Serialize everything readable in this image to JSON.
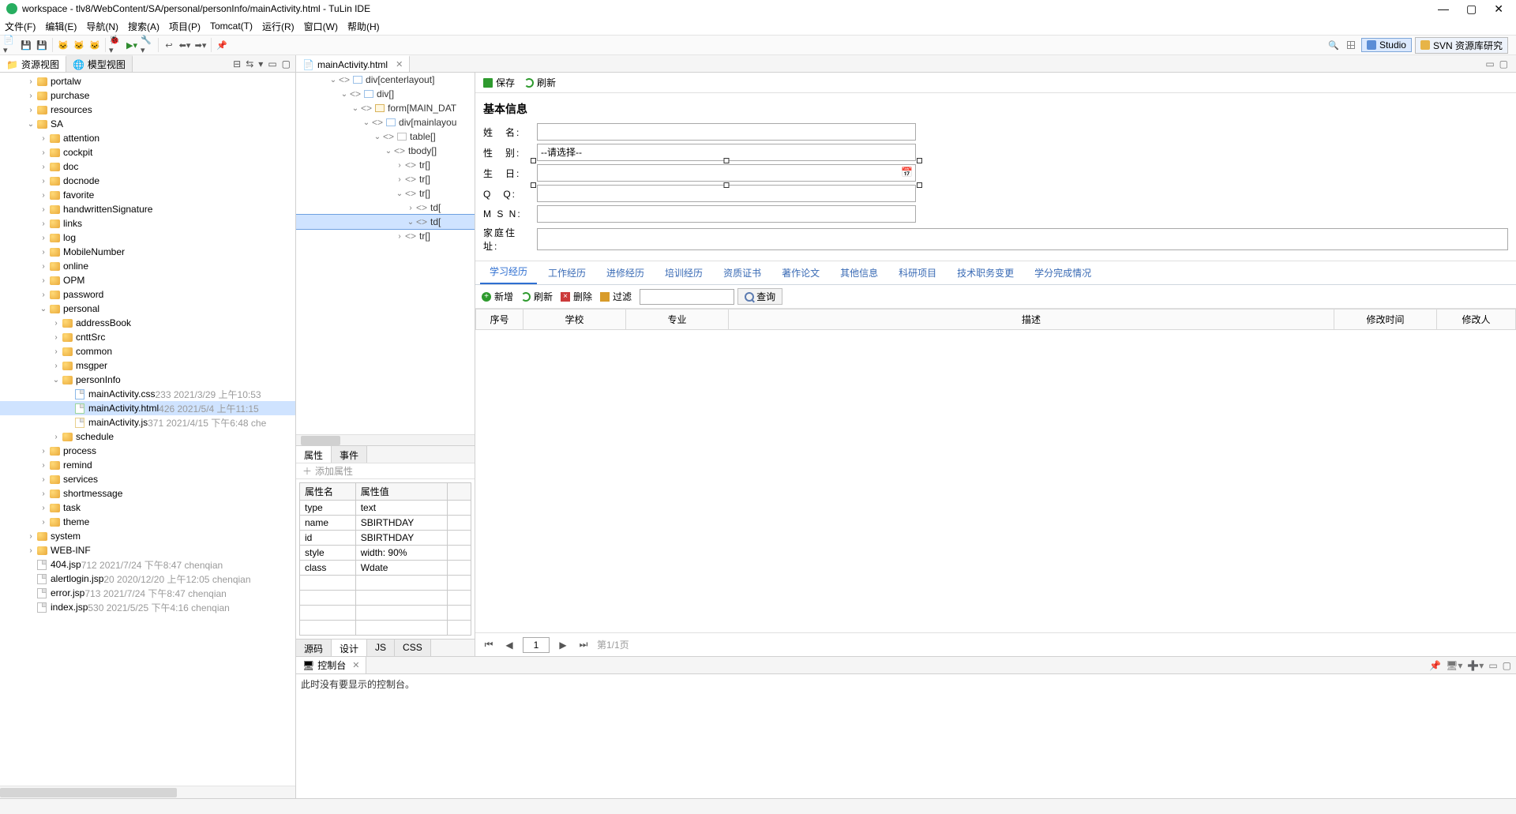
{
  "window": {
    "title": "workspace - tlv8/WebContent/SA/personal/personInfo/mainActivity.html - TuLin IDE"
  },
  "menubar": [
    "文件(F)",
    "编辑(E)",
    "导航(N)",
    "搜索(A)",
    "项目(P)",
    "Tomcat(T)",
    "运行(R)",
    "窗口(W)",
    "帮助(H)"
  ],
  "perspectives": {
    "studio": "Studio",
    "svn": "SVN 资源库研究"
  },
  "leftViews": {
    "res": "资源视图",
    "model": "模型视图"
  },
  "tree": {
    "items": [
      {
        "indent": 2,
        "label": "portalw",
        "kind": "folder"
      },
      {
        "indent": 2,
        "label": "purchase",
        "kind": "folder"
      },
      {
        "indent": 2,
        "label": "resources",
        "kind": "folder"
      },
      {
        "indent": 2,
        "label": "SA",
        "kind": "folder",
        "open": true
      },
      {
        "indent": 3,
        "label": "attention",
        "kind": "folder"
      },
      {
        "indent": 3,
        "label": "cockpit",
        "kind": "folder"
      },
      {
        "indent": 3,
        "label": "doc",
        "kind": "folder"
      },
      {
        "indent": 3,
        "label": "docnode",
        "kind": "folder"
      },
      {
        "indent": 3,
        "label": "favorite",
        "kind": "folder"
      },
      {
        "indent": 3,
        "label": "handwrittenSignature",
        "kind": "folder"
      },
      {
        "indent": 3,
        "label": "links",
        "kind": "folder"
      },
      {
        "indent": 3,
        "label": "log",
        "kind": "folder"
      },
      {
        "indent": 3,
        "label": "MobileNumber",
        "kind": "folder"
      },
      {
        "indent": 3,
        "label": "online",
        "kind": "folder"
      },
      {
        "indent": 3,
        "label": "OPM",
        "kind": "folder"
      },
      {
        "indent": 3,
        "label": "password",
        "kind": "folder"
      },
      {
        "indent": 3,
        "label": "personal",
        "kind": "folder",
        "open": true
      },
      {
        "indent": 4,
        "label": "addressBook",
        "kind": "folder"
      },
      {
        "indent": 4,
        "label": "cnttSrc",
        "kind": "folder"
      },
      {
        "indent": 4,
        "label": "common",
        "kind": "folder"
      },
      {
        "indent": 4,
        "label": "msgper",
        "kind": "folder"
      },
      {
        "indent": 4,
        "label": "personInfo",
        "kind": "folder",
        "open": true
      },
      {
        "indent": 5,
        "label": "mainActivity.css",
        "kind": "file-css",
        "suffix": "233  2021/3/29 上午10:53"
      },
      {
        "indent": 5,
        "label": "mainActivity.html",
        "kind": "file-html",
        "suffix": "426  2021/5/4 上午11:15",
        "sel": true
      },
      {
        "indent": 5,
        "label": "mainActivity.js",
        "kind": "file-js",
        "suffix": "371  2021/4/15 下午6:48  che"
      },
      {
        "indent": 4,
        "label": "schedule",
        "kind": "folder"
      },
      {
        "indent": 3,
        "label": "process",
        "kind": "folder"
      },
      {
        "indent": 3,
        "label": "remind",
        "kind": "folder"
      },
      {
        "indent": 3,
        "label": "services",
        "kind": "folder"
      },
      {
        "indent": 3,
        "label": "shortmessage",
        "kind": "folder"
      },
      {
        "indent": 3,
        "label": "task",
        "kind": "folder"
      },
      {
        "indent": 3,
        "label": "theme",
        "kind": "folder"
      },
      {
        "indent": 2,
        "label": "system",
        "kind": "folder"
      },
      {
        "indent": 2,
        "label": "WEB-INF",
        "kind": "folder"
      },
      {
        "indent": 2,
        "label": "404.jsp",
        "kind": "file",
        "suffix": "712  2021/7/24 下午8:47  chenqian"
      },
      {
        "indent": 2,
        "label": "alertlogin.jsp",
        "kind": "file",
        "suffix": "20  2020/12/20 上午12:05  chenqian"
      },
      {
        "indent": 2,
        "label": "error.jsp",
        "kind": "file",
        "suffix": "713  2021/7/24 下午8:47  chenqian"
      },
      {
        "indent": 2,
        "label": "index.jsp",
        "kind": "file",
        "suffix": "530  2021/5/25 下午4:16  chenqian"
      }
    ]
  },
  "editorTab": "mainActivity.html",
  "outline": [
    {
      "indent": 0,
      "open": true,
      "ic": "",
      "label": "div[centerlayout]"
    },
    {
      "indent": 1,
      "open": true,
      "ic": "",
      "label": "div[]"
    },
    {
      "indent": 2,
      "open": true,
      "ic": "f",
      "label": "form[MAIN_DAT"
    },
    {
      "indent": 3,
      "open": true,
      "ic": "",
      "label": "div[mainlayou"
    },
    {
      "indent": 4,
      "open": true,
      "ic": "tg",
      "label": "table[]"
    },
    {
      "indent": 5,
      "open": true,
      "ic": "tg",
      "label": "tbody[]"
    },
    {
      "indent": 6,
      "open": false,
      "ic": "tg",
      "label": "tr[]"
    },
    {
      "indent": 6,
      "open": false,
      "ic": "tg",
      "label": "tr[]"
    },
    {
      "indent": 6,
      "open": true,
      "ic": "tg",
      "label": "tr[]"
    },
    {
      "indent": 7,
      "open": false,
      "ic": "tg",
      "label": "td["
    },
    {
      "indent": 7,
      "open": true,
      "ic": "tg",
      "label": "td[",
      "sel": true
    },
    {
      "indent": 6,
      "open": false,
      "ic": "tg",
      "label": "tr[]"
    }
  ],
  "propTabs": {
    "prop": "属性",
    "evt": "事件"
  },
  "addProp": "添加属性",
  "propTable": {
    "headers": [
      "属性名",
      "属性值"
    ],
    "rows": [
      [
        "type",
        "text"
      ],
      [
        "name",
        "SBIRTHDAY"
      ],
      [
        "id",
        "SBIRTHDAY"
      ],
      [
        "style",
        "width: 90%"
      ],
      [
        "class",
        "Wdate"
      ]
    ]
  },
  "bottomTabs": {
    "src": "源码",
    "design": "设计",
    "js": "JS",
    "css": "CSS"
  },
  "pv": {
    "save": "保存",
    "refresh": "刷新",
    "title": "基本信息",
    "labels": {
      "name": "姓　名:",
      "sex": "性　别:",
      "birthday": "生　日:",
      "qq": "Q　Q:",
      "msn": "M S N:",
      "addr": "家庭住址:"
    },
    "sexPlaceholder": "--请选择--"
  },
  "subTabs": [
    "学习经历",
    "工作经历",
    "进修经历",
    "培训经历",
    "资质证书",
    "著作论文",
    "其他信息",
    "科研项目",
    "技术职务变更",
    "学分完成情况"
  ],
  "gridbar": {
    "add": "新增",
    "refresh": "刷新",
    "del": "删除",
    "filter": "过滤",
    "search": "查询"
  },
  "gridCols": [
    "序号",
    "学校",
    "专业",
    "描述",
    "修改时间",
    "修改人"
  ],
  "pager": {
    "page": "1",
    "info": "第1/1页"
  },
  "console": {
    "tab": "控制台",
    "msg": "此时没有要显示的控制台。"
  }
}
